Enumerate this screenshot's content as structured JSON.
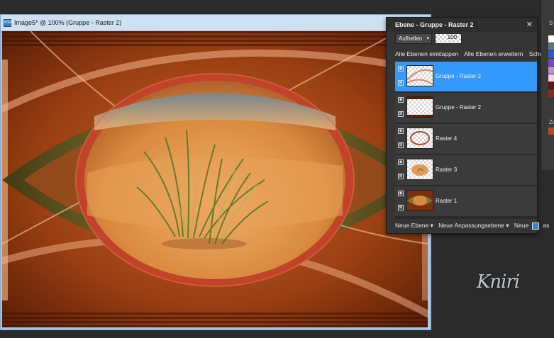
{
  "image_window": {
    "title": "Image5* @ 100% (Gruppe - Raster 2)",
    "app_icon_text": "PSP",
    "minimize_icon": "minimize-icon",
    "maximize_icon": "maximize-icon"
  },
  "layers_panel": {
    "title": "Ebene - Gruppe - Raster 2",
    "close_glyph": "✕",
    "blend_mode": "Aufhellen",
    "blend_caret": "▾",
    "opacity": "100",
    "actions": [
      "Alle Ebenen einklappen",
      "Alle Ebenen erweitern",
      "Schnel"
    ],
    "layers": [
      {
        "name": "Gruppe - Raster 2",
        "selected": true
      },
      {
        "name": "Gruppe - Raster 2",
        "selected": false
      },
      {
        "name": "Raster 4",
        "selected": false
      },
      {
        "name": "Raster 3",
        "selected": false
      },
      {
        "name": "Raster 1",
        "selected": false
      }
    ],
    "bottom": {
      "new_layer": "Neue Ebene ▾",
      "new_adjustment_layer": "Neue Anpassungsebene ▾",
      "new_partial": "Neue",
      "as_partial": "as"
    }
  },
  "right_panel": {
    "text1": "S",
    "text2": "Zu",
    "swatches": [
      "#ffffff",
      "#5a7a78",
      "#3355dd",
      "#7a44cc",
      "#c48cd0",
      "#f2d0ea",
      "#5a1818",
      "#8a2a22"
    ]
  },
  "signature": "Kniri",
  "colors": {
    "accent": "#3399ff",
    "canvas_base": "#7a2f0d"
  }
}
